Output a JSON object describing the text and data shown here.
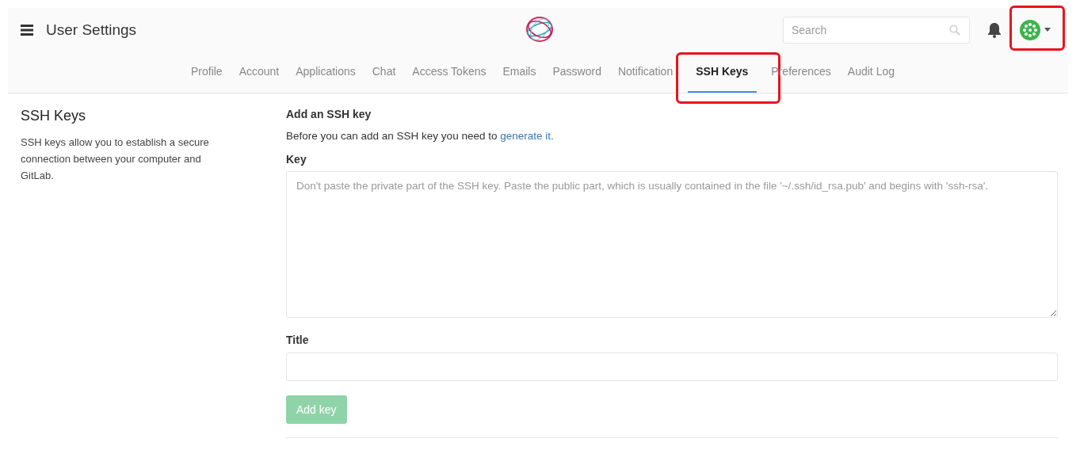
{
  "header": {
    "title": "User Settings",
    "search": {
      "placeholder": "Search"
    },
    "avatar": {
      "highlighted": true
    }
  },
  "tabs": [
    {
      "label": "Profile",
      "selected": false,
      "highlighted": false
    },
    {
      "label": "Account",
      "selected": false,
      "highlighted": false
    },
    {
      "label": "Applications",
      "selected": false,
      "highlighted": false
    },
    {
      "label": "Chat",
      "selected": false,
      "highlighted": false
    },
    {
      "label": "Access Tokens",
      "selected": false,
      "highlighted": false
    },
    {
      "label": "Emails",
      "selected": false,
      "highlighted": false
    },
    {
      "label": "Password",
      "selected": false,
      "highlighted": false
    },
    {
      "label": "Notification",
      "selected": false,
      "highlighted": false
    },
    {
      "label": "SSH Keys",
      "selected": true,
      "highlighted": true
    },
    {
      "label": "Preferences",
      "selected": false,
      "highlighted": false
    },
    {
      "label": "Audit Log",
      "selected": false,
      "highlighted": false
    }
  ],
  "sidebar": {
    "title": "SSH Keys",
    "description": "SSH keys allow you to establish a secure connection between your computer and GitLab."
  },
  "form": {
    "heading": "Add an SSH key",
    "intro": "Before you can add an SSH key you need to",
    "intro_link": "generate it.",
    "key_label": "Key",
    "key_placeholder": "Don't paste the private part of the SSH key. Paste the public part, which is usually contained in the file '~/.ssh/id_rsa.pub' and begins with 'ssh-rsa'.",
    "title_label": "Title",
    "submit": {
      "label": "Add key",
      "disabled": true
    }
  }
}
